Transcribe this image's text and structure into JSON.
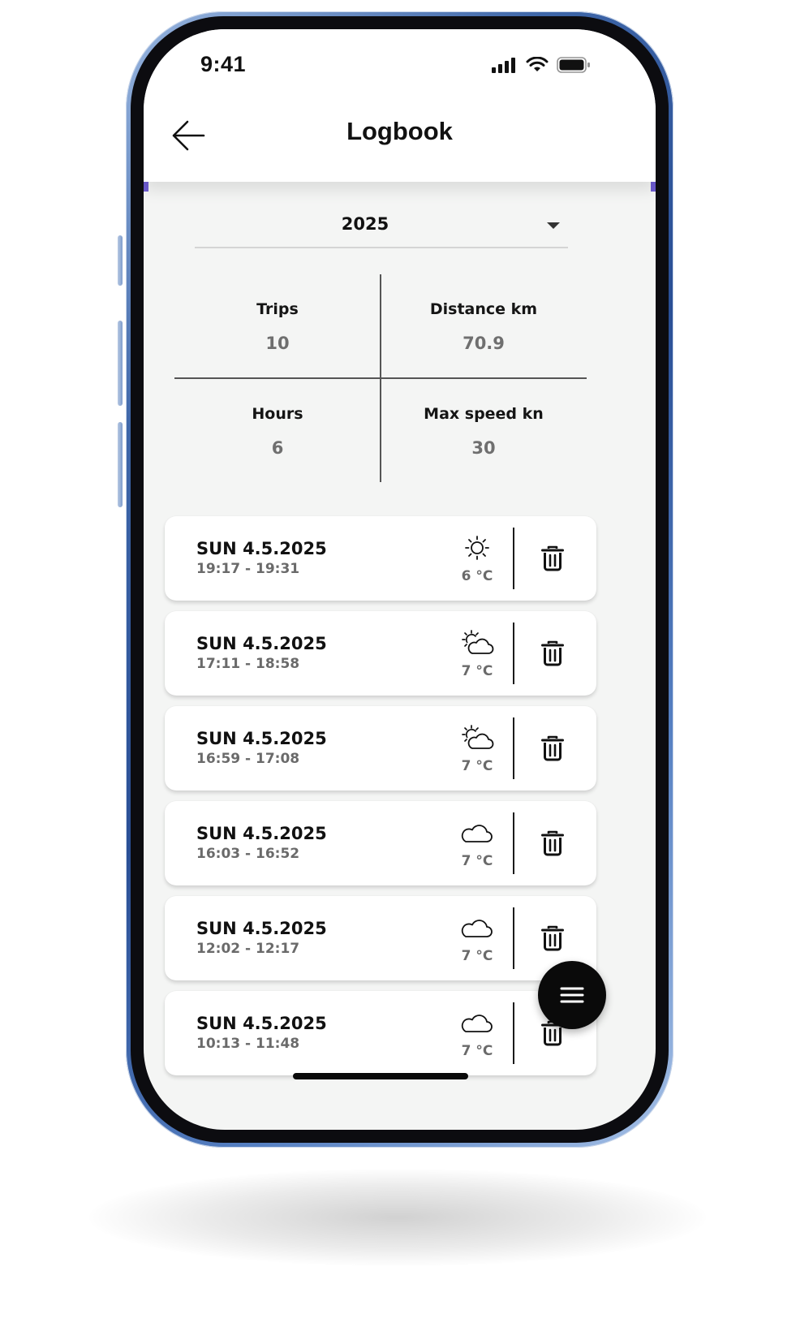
{
  "status_bar": {
    "time": "9:41",
    "icons": [
      "signal-icon",
      "wifi-icon",
      "battery-icon"
    ]
  },
  "header": {
    "title": "Logbook",
    "back_icon": "arrow-left-icon"
  },
  "year_select": {
    "value": "2025",
    "icon": "caret-down-icon"
  },
  "stats": {
    "trips": {
      "label": "Trips",
      "value": "10"
    },
    "distance": {
      "label": "Distance km",
      "value": "70.9"
    },
    "hours": {
      "label": "Hours",
      "value": "6"
    },
    "max_speed": {
      "label": "Max speed kn",
      "value": "30"
    }
  },
  "trips": [
    {
      "date": "SUN 4.5.2025",
      "time": "19:17 - 19:31",
      "weather": "sun-icon",
      "temp": "6 °C"
    },
    {
      "date": "SUN 4.5.2025",
      "time": "17:11 - 18:58",
      "weather": "partly-cloudy-icon",
      "temp": "7 °C"
    },
    {
      "date": "SUN 4.5.2025",
      "time": "16:59 - 17:08",
      "weather": "partly-cloudy-icon",
      "temp": "7 °C"
    },
    {
      "date": "SUN 4.5.2025",
      "time": "16:03 - 16:52",
      "weather": "cloud-icon",
      "temp": "7 °C"
    },
    {
      "date": "SUN 4.5.2025",
      "time": "12:02 - 12:17",
      "weather": "cloud-icon",
      "temp": "7 °C"
    },
    {
      "date": "SUN 4.5.2025",
      "time": "10:13 - 11:48",
      "weather": "cloud-icon",
      "temp": "7 °C"
    }
  ],
  "fab": {
    "icon": "menu-icon"
  },
  "colors": {
    "background": "#f4f5f4",
    "card": "#ffffff",
    "text": "#111111",
    "muted": "#6a6a6a",
    "fab": "#0a0a0a",
    "frame": "#2a4f95"
  }
}
